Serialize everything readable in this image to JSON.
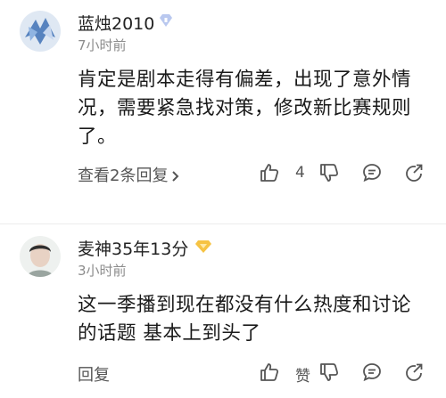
{
  "comments": [
    {
      "username": "蓝烛2010",
      "time": "7小时前",
      "content": "肯定是剧本走得有偏差，出现了意外情况，需要紧急找对策，修改新比赛规则了。",
      "reply_label": "查看2条回复",
      "like_count": "4",
      "badge_color": "#b9c8ef"
    },
    {
      "username": "麦神35年13分",
      "time": "3小时前",
      "content": "这一季播到现在都没有什么热度和讨论的话题 基本上到头了",
      "reply_label": "回复",
      "like_count": "赞",
      "badge_color": "#f6c343"
    }
  ],
  "icons": [
    "thumbs-up-icon",
    "thumbs-down-icon",
    "message-icon",
    "share-icon",
    "chevron-right-icon"
  ]
}
